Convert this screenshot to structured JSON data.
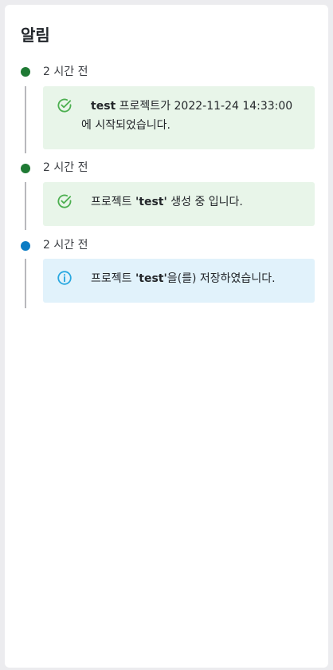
{
  "panel": {
    "title": "알림"
  },
  "notifications": [
    {
      "type": "success",
      "time": "2 시간 전",
      "message_prefix": "test",
      "message_rest": " 프로젝트가 2022-11-24 14:33:00",
      "message_line2": "에 시작되었습니다.",
      "icon": "check-circle-icon",
      "color": "#1f7a34"
    },
    {
      "type": "success",
      "time": "2 시간 전",
      "message_prefix": "프로젝트 ",
      "message_bold": "'test'",
      "message_rest": " 생성 중 입니다.",
      "icon": "check-circle-icon",
      "color": "#1f7a34"
    },
    {
      "type": "info",
      "time": "2 시간 전",
      "message_prefix": "프로젝트 ",
      "message_bold": "'test'",
      "message_rest": "을(를) 저장하였습니다.",
      "icon": "info-circle-icon",
      "color": "#0b7cc4"
    }
  ],
  "colors": {
    "success_dot": "#1f7a34",
    "success_bg": "#e8f5e9",
    "success_icon": "#4caf50",
    "info_dot": "#0b7cc4",
    "info_bg": "#e1f2fb",
    "info_icon": "#29a8e0"
  }
}
